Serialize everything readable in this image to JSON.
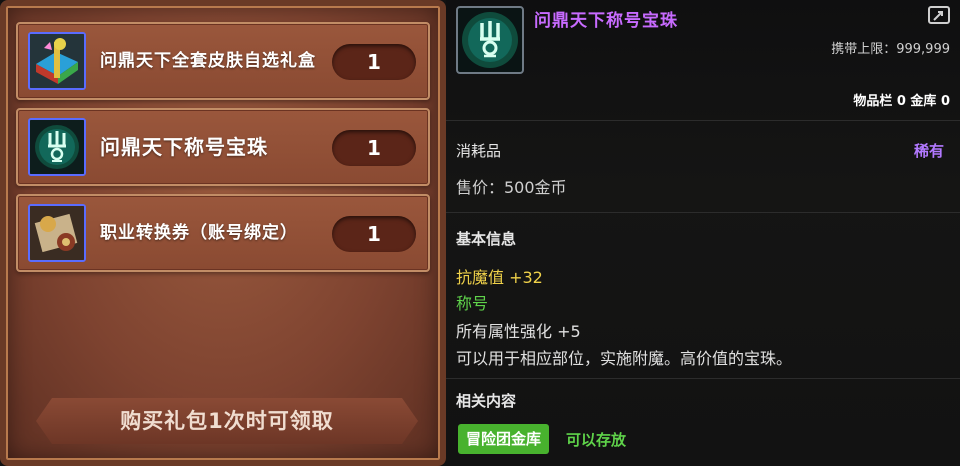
{
  "rewards": {
    "items": [
      {
        "name": "问鼎天下全套皮肤自选礼盒",
        "qty": "1"
      },
      {
        "name": "问鼎天下称号宝珠",
        "qty": "1"
      },
      {
        "name": "职业转换券（账号绑定）",
        "qty": "1"
      }
    ],
    "claim_label": "购买礼包1次时可领取"
  },
  "tooltip": {
    "title": "问鼎天下称号宝珠",
    "carry_limit_label": "携带上限：",
    "carry_limit_value": "999,999",
    "storage_text": "物品栏 0 金库 0",
    "category": "消耗品",
    "rarity": "稀有",
    "price": "售价：500金币",
    "basic_info_header": "基本信息",
    "stat_line": "抗魔值 +32",
    "title_tag": "称号",
    "all_stats": "所有属性强化 +5",
    "description": "可以用于相应部位，实施附魔。高价值的宝珠。",
    "related_header": "相关内容",
    "related_button": "冒险团金库",
    "related_note": "可以存放",
    "colors": {
      "title": "#c86bff",
      "rare": "#b279ff",
      "stat": "#f0d24a",
      "green": "#5fd34a"
    }
  }
}
